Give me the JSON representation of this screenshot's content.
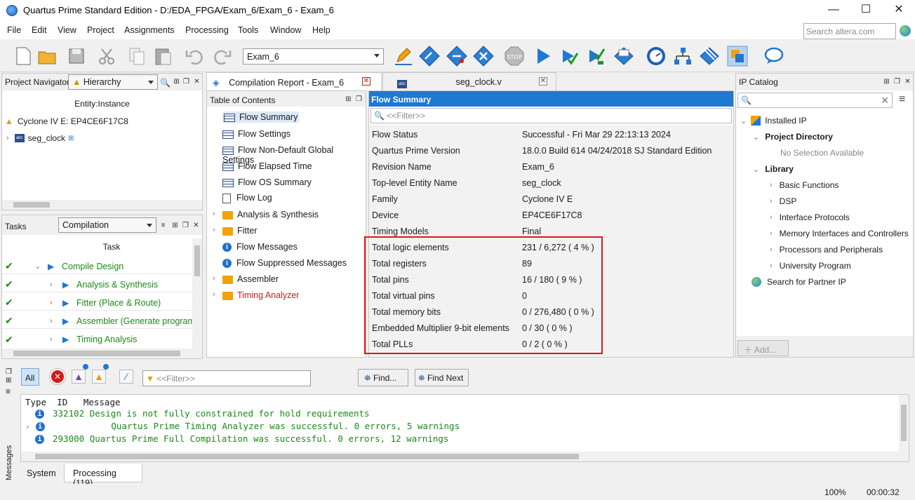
{
  "window": {
    "title": "Quartus Prime Standard Edition - D:/EDA_FPGA/Exam_6/Exam_6 - Exam_6",
    "minimize": "—",
    "maximize": "☐",
    "close": "✕"
  },
  "menu": {
    "items": [
      "File",
      "Edit",
      "View",
      "Project",
      "Assignments",
      "Processing",
      "Tools",
      "Window",
      "Help"
    ],
    "search_placeholder": "Search altera.com"
  },
  "toolbar": {
    "revision": "Exam_6"
  },
  "navigator": {
    "title": "Project Navigator",
    "view": "Hierarchy",
    "column": "Entity:Instance",
    "device": "Cyclone IV E: EP4CE6F17C8",
    "top_entity": "seg_clock"
  },
  "tasks": {
    "title": "Tasks",
    "flow": "Compilation",
    "column": "Task",
    "items": [
      {
        "label": "Compile Design",
        "status": "✔"
      },
      {
        "label": "Analysis & Synthesis",
        "status": "✔"
      },
      {
        "label": "Fitter (Place & Route)",
        "status": "✔"
      },
      {
        "label": "Assembler (Generate programm",
        "status": "✔"
      },
      {
        "label": "Timing Analysis",
        "status": "✔"
      }
    ]
  },
  "tabs": {
    "report": "Compilation Report - Exam_6",
    "file": "seg_clock.v",
    "close": "✕"
  },
  "toc": {
    "title": "Table of Contents",
    "items": [
      {
        "label": "Flow Summary",
        "icon": "table-icon"
      },
      {
        "label": "Flow Settings",
        "icon": "table-icon"
      },
      {
        "label": "Flow Non-Default Global Settings",
        "icon": "table-icon"
      },
      {
        "label": "Flow Elapsed Time",
        "icon": "table-icon"
      },
      {
        "label": "Flow OS Summary",
        "icon": "table-icon"
      },
      {
        "label": "Flow Log",
        "icon": "document-icon"
      },
      {
        "label": "Analysis & Synthesis",
        "icon": "folder-icon"
      },
      {
        "label": "Fitter",
        "icon": "folder-icon"
      },
      {
        "label": "Flow Messages",
        "icon": "info-icon"
      },
      {
        "label": "Flow Suppressed Messages",
        "icon": "info-icon"
      },
      {
        "label": "Assembler",
        "icon": "folder-icon"
      },
      {
        "label": "Timing Analyzer",
        "icon": "folder-icon"
      }
    ]
  },
  "flow_summary": {
    "title": "Flow Summary",
    "filter_placeholder": "<<Filter>>",
    "rows": [
      {
        "key": "Flow Status",
        "value": "Successful - Fri Mar 29 22:13:13 2024"
      },
      {
        "key": "Quartus Prime Version",
        "value": "18.0.0 Build 614 04/24/2018 SJ Standard Edition"
      },
      {
        "key": "Revision Name",
        "value": "Exam_6"
      },
      {
        "key": "Top-level Entity Name",
        "value": "seg_clock"
      },
      {
        "key": "Family",
        "value": "Cyclone IV E"
      },
      {
        "key": "Device",
        "value": "EP4CE6F17C8"
      },
      {
        "key": "Timing Models",
        "value": "Final"
      },
      {
        "key": "Total logic elements",
        "value": "231 / 6,272 ( 4 % )"
      },
      {
        "key": "Total registers",
        "value": "89"
      },
      {
        "key": "Total pins",
        "value": "16 / 180 ( 9 % )"
      },
      {
        "key": "Total virtual pins",
        "value": "0"
      },
      {
        "key": "Total memory bits",
        "value": "0 / 276,480 ( 0 % )"
      },
      {
        "key": "Embedded Multiplier 9-bit elements",
        "value": "0 / 30 ( 0 % )"
      },
      {
        "key": "Total PLLs",
        "value": "0 / 2 ( 0 % )"
      }
    ]
  },
  "ip_catalog": {
    "title": "IP Catalog",
    "installed": "Installed IP",
    "project_dir": "Project Directory",
    "no_selection": "No Selection Available",
    "library": "Library",
    "library_items": [
      "Basic Functions",
      "DSP",
      "Interface Protocols",
      "Memory Interfaces and Controllers",
      "Processors and Peripherals",
      "University Program"
    ],
    "partner": "Search for Partner IP",
    "add": "Add..."
  },
  "messages": {
    "all": "All",
    "filter_placeholder": "<<Filter>>",
    "find": "Find...",
    "find_next": "Find Next",
    "header": {
      "type": "Type",
      "id": "ID",
      "message": "Message"
    },
    "rows": [
      {
        "id": "332102",
        "text": "Design is not fully constrained for hold requirements"
      },
      {
        "id": "",
        "text": "     Quartus Prime Timing Analyzer was successful. 0 errors, 5 warnings"
      },
      {
        "id": "293000",
        "text": "Quartus Prime Full Compilation was successful. 0 errors, 12 warnings"
      }
    ],
    "side_label": "Messages",
    "tab_system": "System",
    "tab_processing": "Processing (119)"
  },
  "status": {
    "zoom": "100%",
    "time": "00:00:32"
  },
  "colors": {
    "accent": "#1f78d1",
    "success": "#1a8a1a",
    "highlight_border": "#e01818"
  }
}
